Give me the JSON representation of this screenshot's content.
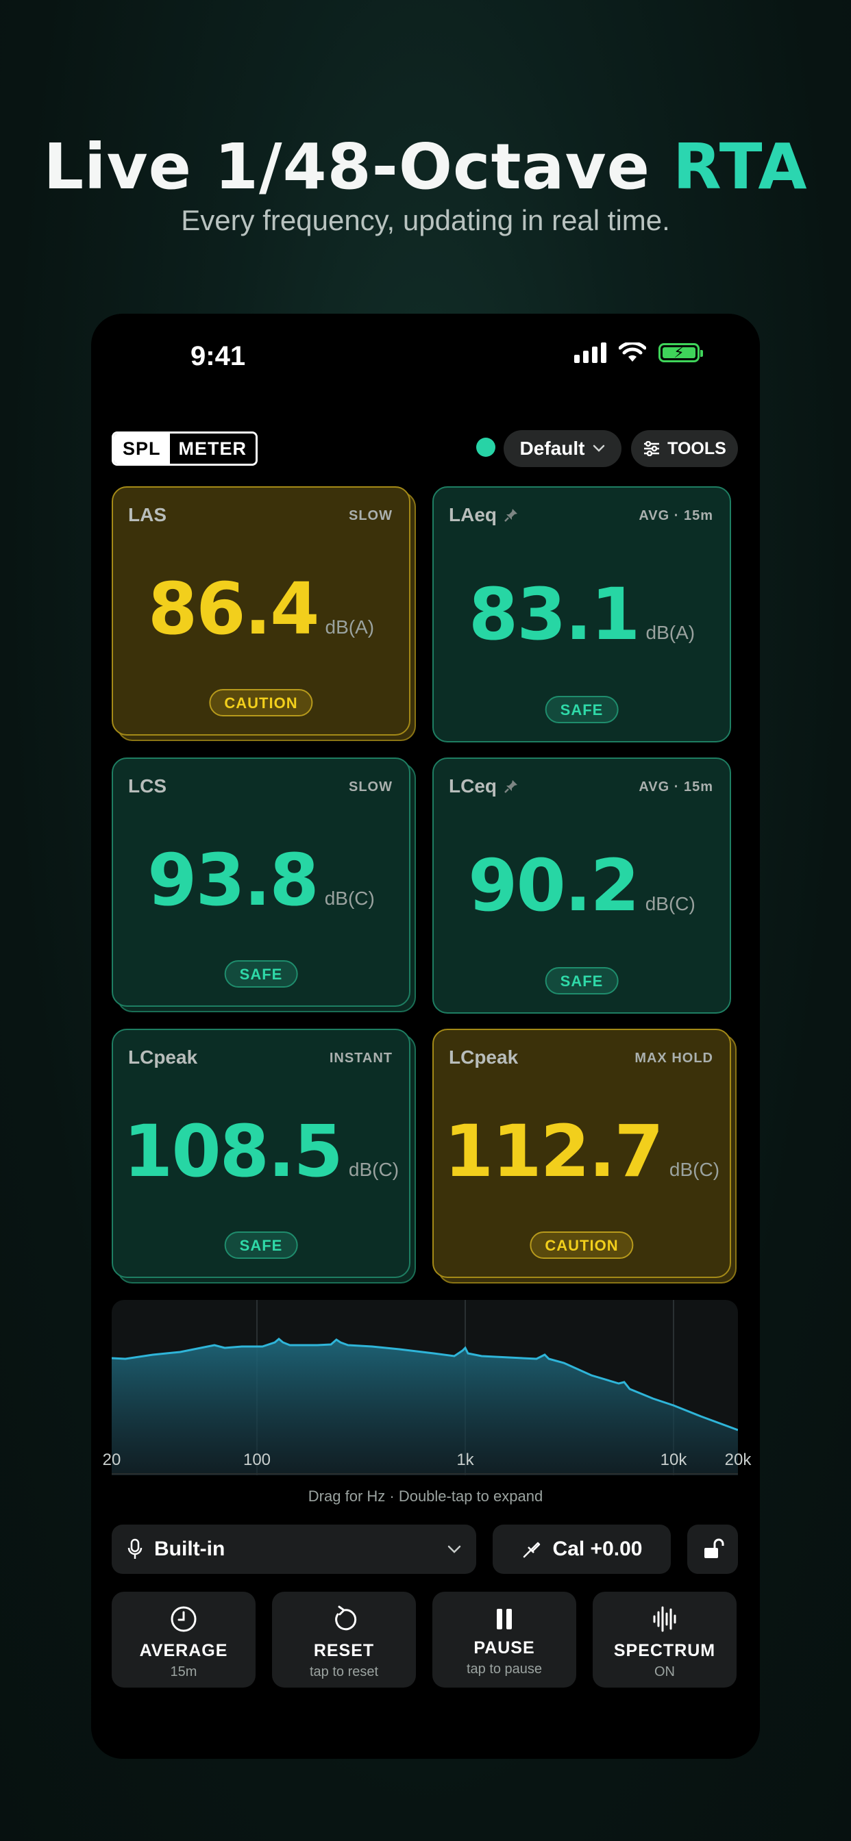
{
  "hero": {
    "title_main": "Live 1/48-Octave ",
    "title_accent": "RTA",
    "subtitle": "Every frequency, updating in real time."
  },
  "status_bar": {
    "time": "9:41"
  },
  "header": {
    "brand_left": "SPL",
    "brand_right": "METER",
    "preset": "Default",
    "tools": "TOOLS"
  },
  "meters": [
    {
      "label": "LAS",
      "mode": "SLOW",
      "value": "86.4",
      "unit": "dB(A)",
      "status": "CAUTION",
      "pinned": false,
      "color": "#f2cf1c"
    },
    {
      "label": "LAeq",
      "mode": "AVG · 15m",
      "value": "83.1",
      "unit": "dB(A)",
      "status": "SAFE",
      "pinned": true,
      "color": "#27d6a4"
    },
    {
      "label": "LCS",
      "mode": "SLOW",
      "value": "93.8",
      "unit": "dB(C)",
      "status": "SAFE",
      "pinned": false,
      "color": "#27d6a4"
    },
    {
      "label": "LCeq",
      "mode": "AVG · 15m",
      "value": "90.2",
      "unit": "dB(C)",
      "status": "SAFE",
      "pinned": true,
      "color": "#27d6a4"
    },
    {
      "label": "LCpeak",
      "mode": "INSTANT",
      "value": "108.5",
      "unit": "dB(C)",
      "status": "SAFE",
      "pinned": false,
      "color": "#27d6a4"
    },
    {
      "label": "LCpeak",
      "mode": "MAX HOLD",
      "value": "112.7",
      "unit": "dB(C)",
      "status": "CAUTION",
      "pinned": false,
      "color": "#f2cf1c"
    }
  ],
  "spectrum": {
    "tick_labels": [
      "20",
      "100",
      "1k",
      "10k",
      "20k"
    ],
    "hint": "Drag for Hz · Double-tap to expand",
    "line_color": "#2fb5d9"
  },
  "input": {
    "mic": "Built-in",
    "calibration": "Cal +0.00"
  },
  "controls": [
    {
      "title": "AVERAGE",
      "sub": "15m",
      "icon": "clock-icon"
    },
    {
      "title": "RESET",
      "sub": "tap to reset",
      "icon": "reset-icon"
    },
    {
      "title": "PAUSE",
      "sub": "tap to pause",
      "icon": "pause-icon"
    },
    {
      "title": "SPECTRUM",
      "sub": "ON",
      "icon": "waveform-icon"
    }
  ]
}
